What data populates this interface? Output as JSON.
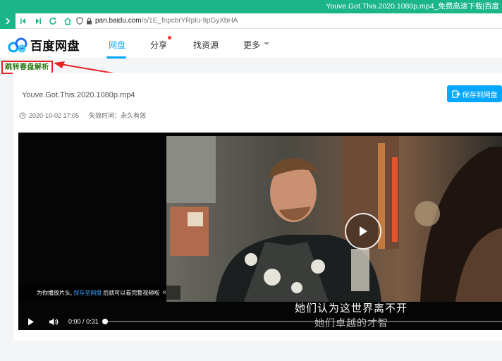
{
  "browser": {
    "window_title": "Youve.Got.This.2020.1080p.mp4_免费高速下载|百度",
    "url_host": "pan.baidu.com",
    "url_path": "/s/1E_fnpcbrYRplu-9pGyXbHA"
  },
  "header": {
    "logo_text": "百度网盘",
    "nav": [
      {
        "label": "网盘",
        "active": true
      },
      {
        "label": "分享",
        "badge": true
      },
      {
        "label": "找资源"
      },
      {
        "label": "更多"
      }
    ]
  },
  "annotation": {
    "jump_label": "跳转春盘解析"
  },
  "file": {
    "name": "Youve.Got.This.2020.1080p.mp4",
    "save_button": "保存到网盘",
    "date": "2020-10-02 17:05",
    "expiry": "失效时间：永久有效"
  },
  "player": {
    "hint_prefix": "为你播放片头,",
    "hint_link": "保存至网盘",
    "hint_suffix": "后就可以看完整视频啦",
    "hint_close": "×",
    "subtitle_main": "她们认为这世界离不开",
    "subtitle_secondary": "她们卓越的才智",
    "time_current": "0:00",
    "time_separator": "/",
    "time_total": "0:31",
    "progress": 0.0
  },
  "colors": {
    "browser_accent": "#1bb58a",
    "brand_blue": "#06a7ff",
    "annotation_red": "#e52222",
    "annotation_text_green": "#2a7a14"
  }
}
